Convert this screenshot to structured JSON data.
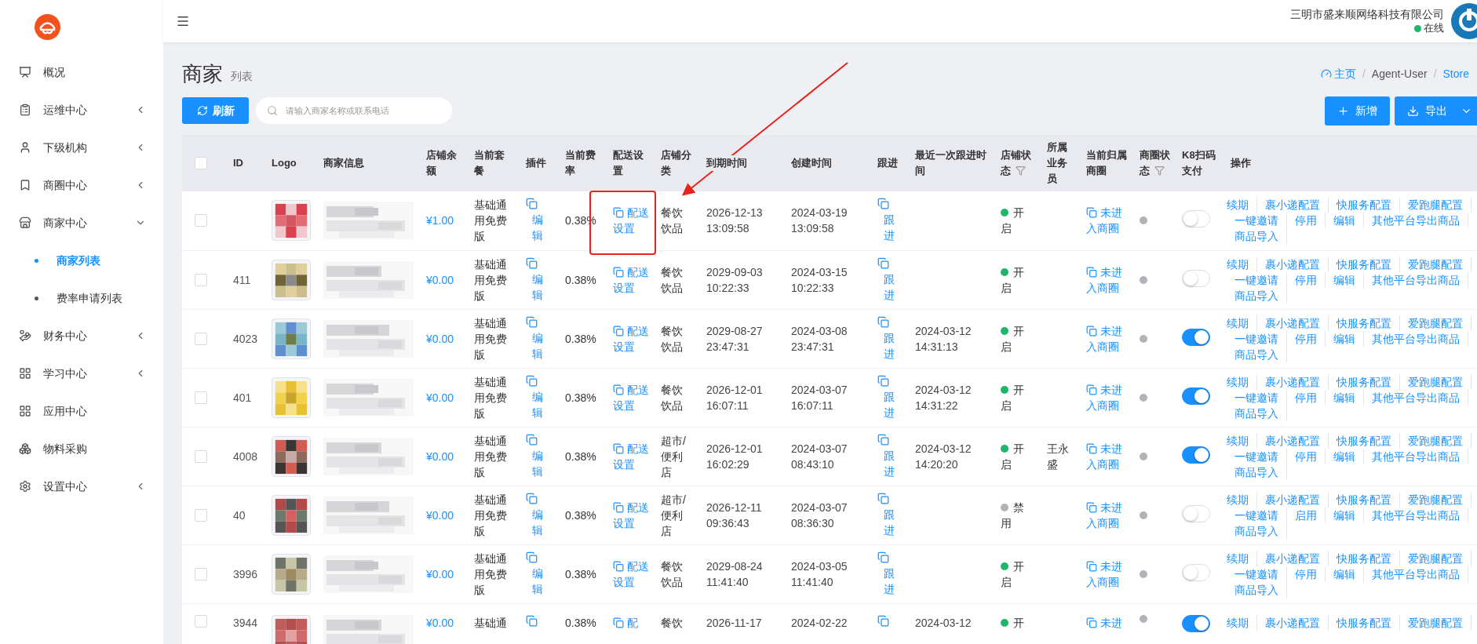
{
  "sidebar": {
    "items": [
      {
        "label": "概况",
        "expandable": false,
        "expanded": false
      },
      {
        "label": "运维中心",
        "expandable": true,
        "expanded": false
      },
      {
        "label": "下级机构",
        "expandable": true,
        "expanded": false
      },
      {
        "label": "商圈中心",
        "expandable": true,
        "expanded": false
      },
      {
        "label": "商家中心",
        "expandable": true,
        "expanded": true,
        "children": [
          {
            "label": "商家列表",
            "selected": true
          },
          {
            "label": "费率申请列表",
            "selected": false
          }
        ]
      },
      {
        "label": "财务中心",
        "expandable": true,
        "expanded": false
      },
      {
        "label": "学习中心",
        "expandable": true,
        "expanded": false
      },
      {
        "label": "应用中心",
        "expandable": false,
        "expanded": false
      },
      {
        "label": "物料采购",
        "expandable": false,
        "expanded": false
      },
      {
        "label": "设置中心",
        "expandable": true,
        "expanded": false
      }
    ]
  },
  "header": {
    "company": "三明市盛来顺网络科技有限公司",
    "status": "在线",
    "online": true
  },
  "page": {
    "title": "商家",
    "subtitle": "列表"
  },
  "breadcrumb": [
    {
      "label": "主页",
      "link": true
    },
    {
      "sep": "/",
      "label": "Agent-User",
      "link": false
    },
    {
      "sep": "/",
      "label": "Store",
      "link": true
    }
  ],
  "toolbar": {
    "refresh": "刷新",
    "search": {
      "placeholder": "请输入商家名称或联系电话"
    },
    "add": "新增",
    "export": "导出"
  },
  "table": {
    "header_checked": false,
    "columns": [
      {
        "label": "ID",
        "filterable": false
      },
      {
        "label": "Logo",
        "filterable": false
      },
      {
        "label": "商家信息",
        "filterable": false
      },
      {
        "label": "店铺余额",
        "filterable": false
      },
      {
        "label": "当前套餐",
        "filterable": false
      },
      {
        "label": "插件",
        "filterable": false
      },
      {
        "label": "当前费率",
        "filterable": false
      },
      {
        "label": "配送设置",
        "filterable": false
      },
      {
        "label": "店铺分类",
        "filterable": false
      },
      {
        "label": "到期时间",
        "filterable": false
      },
      {
        "label": "创建时间",
        "filterable": false
      },
      {
        "label": "跟进",
        "filterable": false
      },
      {
        "label": "最近一次跟进时间",
        "filterable": false
      },
      {
        "label": "店铺状态",
        "filterable": true
      },
      {
        "label": "所属业务员",
        "filterable": false
      },
      {
        "label": "当前归属商圈",
        "filterable": false
      },
      {
        "label": "商圈状态",
        "filterable": true
      },
      {
        "label": "K8扫码支付",
        "filterable": false
      },
      {
        "label": "操作",
        "filterable": false
      }
    ],
    "rows": [
      {
        "checked": false,
        "balance": "¥1.00",
        "plan": "基础通用免费版",
        "plugin": "编辑",
        "rate": "0.38%",
        "delivery": "配送设置",
        "category": "餐饮饮品",
        "expire": "2026-12-13 13:09:58",
        "created": "2024-03-19 13:09:58",
        "follow": "跟进",
        "store_status": "开启",
        "store_on": true,
        "circle": "未进入商圈",
        "k8_on": false,
        "actions": [
          "续期",
          "裹小递配置",
          "快服务配置",
          "爱跑腿配置",
          "一键邀请",
          "停用",
          "编辑",
          "其他平台导出商品",
          "商品导入"
        ]
      },
      {
        "checked": false,
        "id": "411",
        "balance": "¥0.00",
        "plan": "基础通用免费版",
        "plugin": "编辑",
        "rate": "0.38%",
        "delivery": "配送设置",
        "category": "餐饮饮品",
        "expire": "2029-09-03 10:22:33",
        "created": "2024-03-15 10:22:33",
        "follow": "跟进",
        "store_status": "开启",
        "store_on": true,
        "circle": "未进入商圈",
        "k8_on": false,
        "actions": [
          "续期",
          "裹小递配置",
          "快服务配置",
          "爱跑腿配置",
          "一键邀请",
          "停用",
          "编辑",
          "其他平台导出商品",
          "商品导入"
        ]
      },
      {
        "checked": false,
        "id": "4023",
        "balance": "¥0.00",
        "plan": "基础通用免费版",
        "plugin": "编辑",
        "rate": "0.38%",
        "delivery": "配送设置",
        "category": "餐饮饮品",
        "expire": "2029-08-27 23:47:31",
        "created": "2024-03-08 23:47:31",
        "follow": "跟进",
        "last_follow": "2024-03-12 14:31:13",
        "store_status": "开启",
        "store_on": true,
        "circle": "未进入商圈",
        "k8_on": true,
        "actions": [
          "续期",
          "裹小递配置",
          "快服务配置",
          "爱跑腿配置",
          "一键邀请",
          "停用",
          "编辑",
          "其他平台导出商品",
          "商品导入"
        ]
      },
      {
        "checked": false,
        "id": "401",
        "balance": "¥0.00",
        "plan": "基础通用免费版",
        "plugin": "编辑",
        "rate": "0.38%",
        "delivery": "配送设置",
        "category": "餐饮饮品",
        "expire": "2026-12-01 16:07:11",
        "created": "2024-03-07 16:07:11",
        "follow": "跟进",
        "last_follow": "2024-03-12 14:31:22",
        "store_status": "开启",
        "store_on": true,
        "circle": "未进入商圈",
        "k8_on": true,
        "actions": [
          "续期",
          "裹小递配置",
          "快服务配置",
          "爱跑腿配置",
          "一键邀请",
          "停用",
          "编辑",
          "其他平台导出商品",
          "商品导入"
        ]
      },
      {
        "checked": false,
        "id": "4008",
        "balance": "¥0.00",
        "plan": "基础通用免费版",
        "plugin": "编辑",
        "rate": "0.38%",
        "delivery": "配送设置",
        "category": "超市/便利店",
        "expire": "2026-12-01 16:02:29",
        "created": "2024-03-07 08:43:10",
        "follow": "跟进",
        "last_follow": "2024-03-12 14:20:20",
        "store_status": "开启",
        "store_on": true,
        "salesperson": "王永盛",
        "circle": "未进入商圈",
        "k8_on": true,
        "actions": [
          "续期",
          "裹小递配置",
          "快服务配置",
          "爱跑腿配置",
          "一键邀请",
          "停用",
          "编辑",
          "其他平台导出商品",
          "商品导入"
        ]
      },
      {
        "checked": false,
        "id": "40",
        "balance": "¥0.00",
        "plan": "基础通用免费版",
        "plugin": "编辑",
        "rate": "0.38%",
        "delivery": "配送设置",
        "category": "超市/便利店",
        "expire": "2026-12-11 09:36:43",
        "created": "2024-03-07 08:36:30",
        "follow": "跟进",
        "store_status": "禁用",
        "store_on": false,
        "circle": "未进入商圈",
        "k8_on": false,
        "actions": [
          "续期",
          "裹小递配置",
          "快服务配置",
          "爱跑腿配置",
          "一键邀请",
          "启用",
          "编辑",
          "其他平台导出商品",
          "商品导入"
        ]
      },
      {
        "checked": false,
        "id": "3996",
        "balance": "¥0.00",
        "plan": "基础通用免费版",
        "plugin": "编辑",
        "rate": "0.38%",
        "delivery": "配送设置",
        "category": "餐饮饮品",
        "expire": "2029-08-24 11:41:40",
        "created": "2024-03-05 11:41:40",
        "follow": "跟进",
        "store_status": "开启",
        "store_on": true,
        "circle": "未进入商圈",
        "k8_on": false,
        "actions": [
          "续期",
          "裹小递配置",
          "快服务配置",
          "爱跑腿配置",
          "一键邀请",
          "停用",
          "编辑",
          "其他平台导出商品",
          "商品导入"
        ]
      },
      {
        "checked": false,
        "id": "3944",
        "balance": "¥0.00",
        "plan": "基础通",
        "rate": "0.38%",
        "delivery": "配",
        "category": "餐饮",
        "expire": "2026-11-17",
        "created": "2024-02-22",
        "last_follow": "2024-03-12",
        "store_status": "开",
        "store_on": true,
        "circle": "未进",
        "k8_on": true,
        "actions": [
          "续期",
          "裹小递配置",
          "快服务配置",
          "爱跑腿配置"
        ]
      }
    ]
  }
}
